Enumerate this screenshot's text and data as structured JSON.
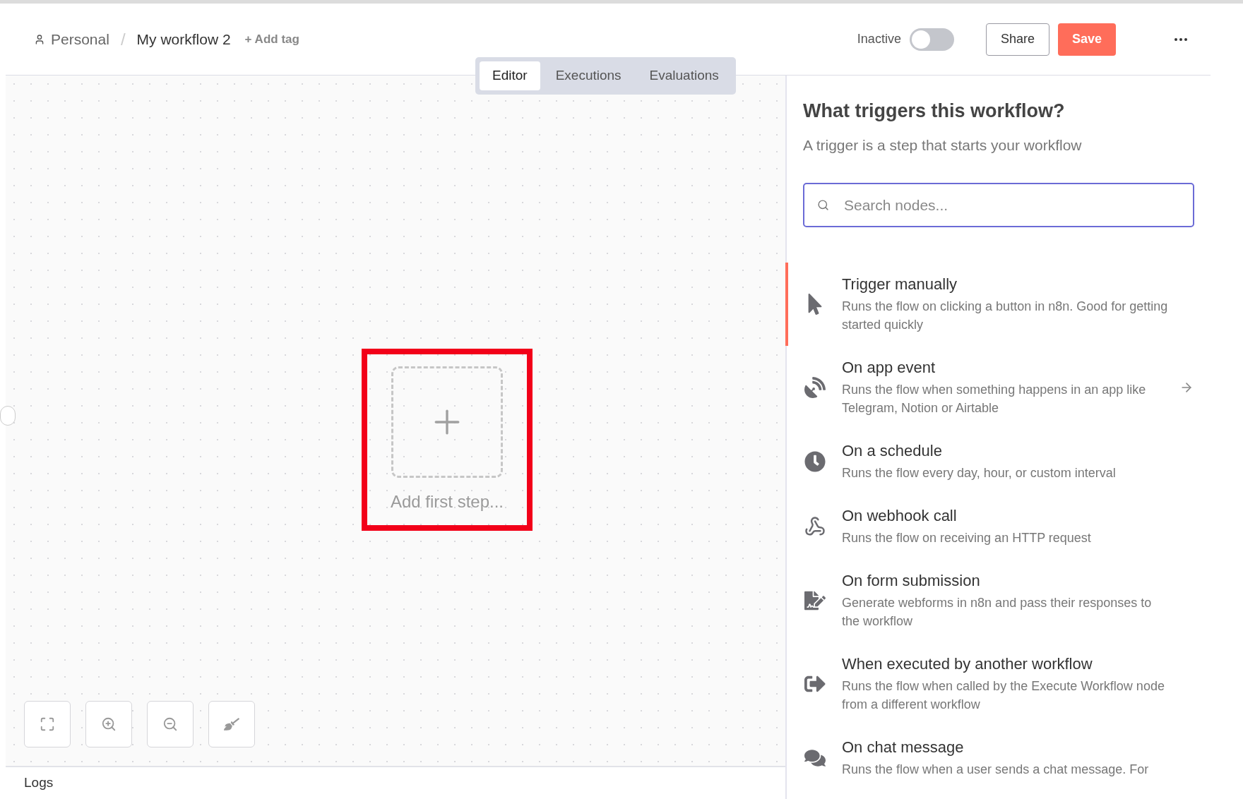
{
  "breadcrumb": {
    "project": "Personal",
    "separator": "/",
    "workflow": "My workflow 2",
    "add_tag": "+ Add tag"
  },
  "status": {
    "label": "Inactive",
    "on": false
  },
  "buttons": [
    {
      "label": "Share",
      "kind": "outline"
    },
    {
      "label": "Save",
      "kind": "primary"
    }
  ],
  "tabs": [
    {
      "label": "Editor",
      "selected": true
    },
    {
      "label": "Executions",
      "selected": false
    },
    {
      "label": "Evaluations",
      "selected": false
    }
  ],
  "canvas": {
    "first_step": "Add first step...",
    "highlighted": true
  },
  "logs": "Logs",
  "panel": {
    "title": "What triggers this workflow?",
    "subtitle": "A trigger is a step that starts your workflow",
    "search": {
      "placeholder": "Search nodes..."
    },
    "items": [
      {
        "kind": "cursor",
        "title": "Trigger manually",
        "description": "Runs the flow on clicking a button in n8n. Good for getting started quickly",
        "selected": true,
        "arrow": false
      },
      {
        "kind": "dish",
        "title": "On app event",
        "description": "Runs the flow when something happens in an app like Telegram, Notion or Airtable",
        "selected": false,
        "arrow": true
      },
      {
        "kind": "clock",
        "title": "On a schedule",
        "description": "Runs the flow every day, hour, or custom interval",
        "selected": false,
        "arrow": false
      },
      {
        "kind": "webhook",
        "title": "On webhook call",
        "description": "Runs the flow on receiving an HTTP request",
        "selected": false,
        "arrow": false
      },
      {
        "kind": "form",
        "title": "On form submission",
        "description": "Generate webforms in n8n and pass their responses to the workflow",
        "selected": false,
        "arrow": false
      },
      {
        "kind": "exit",
        "title": "When executed by another workflow",
        "description": "Runs the flow when called by the Execute Workflow node from a different workflow",
        "selected": false,
        "arrow": false
      },
      {
        "kind": "chat",
        "title": "On chat message",
        "description": "Runs the flow when a user sends a chat message. For",
        "selected": false,
        "arrow": false
      }
    ]
  }
}
